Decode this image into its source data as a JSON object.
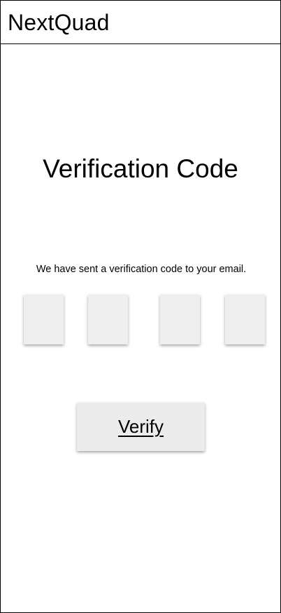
{
  "header": {
    "app_title": "NextQuad"
  },
  "main": {
    "title": "Verification Code",
    "instruction": "We have sent a verification code to your email.",
    "code_inputs": [
      {
        "value": ""
      },
      {
        "value": ""
      },
      {
        "value": ""
      },
      {
        "value": ""
      }
    ],
    "verify_label": "Verify"
  },
  "colors": {
    "background": "#ffffff",
    "input_fill": "#efefef",
    "button_fill": "#ececec",
    "border": "#000000"
  }
}
